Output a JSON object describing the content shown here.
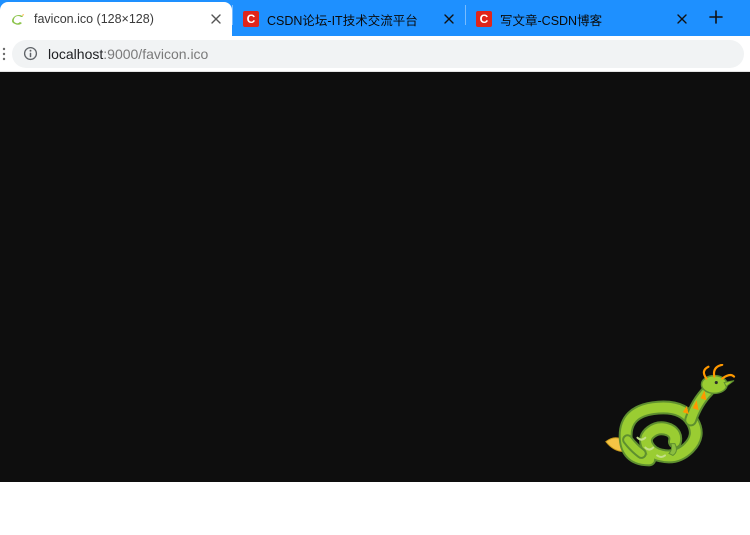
{
  "tabs": [
    {
      "title": "favicon.ico (128×128)",
      "active": true,
      "favicon": "dragon",
      "close": "×"
    },
    {
      "title": "CSDN论坛-IT技术交流平台",
      "active": false,
      "favicon": "csdn",
      "close": "×"
    },
    {
      "title": "写文章-CSDN博客",
      "active": false,
      "favicon": "csdn",
      "close": "×"
    }
  ],
  "newtab_glyph": "+",
  "addressbar": {
    "url_prefix": "localhost",
    "url_suffix": ":9000/favicon.ico"
  },
  "csdn_favicon_letter": "C",
  "colors": {
    "tabstrip_bg": "#1e90ff",
    "viewport_bg": "#0e0e0e",
    "csdn_red": "#e1251b",
    "dragon_green": "#8BC34A",
    "dragon_orange": "#FF9800"
  }
}
